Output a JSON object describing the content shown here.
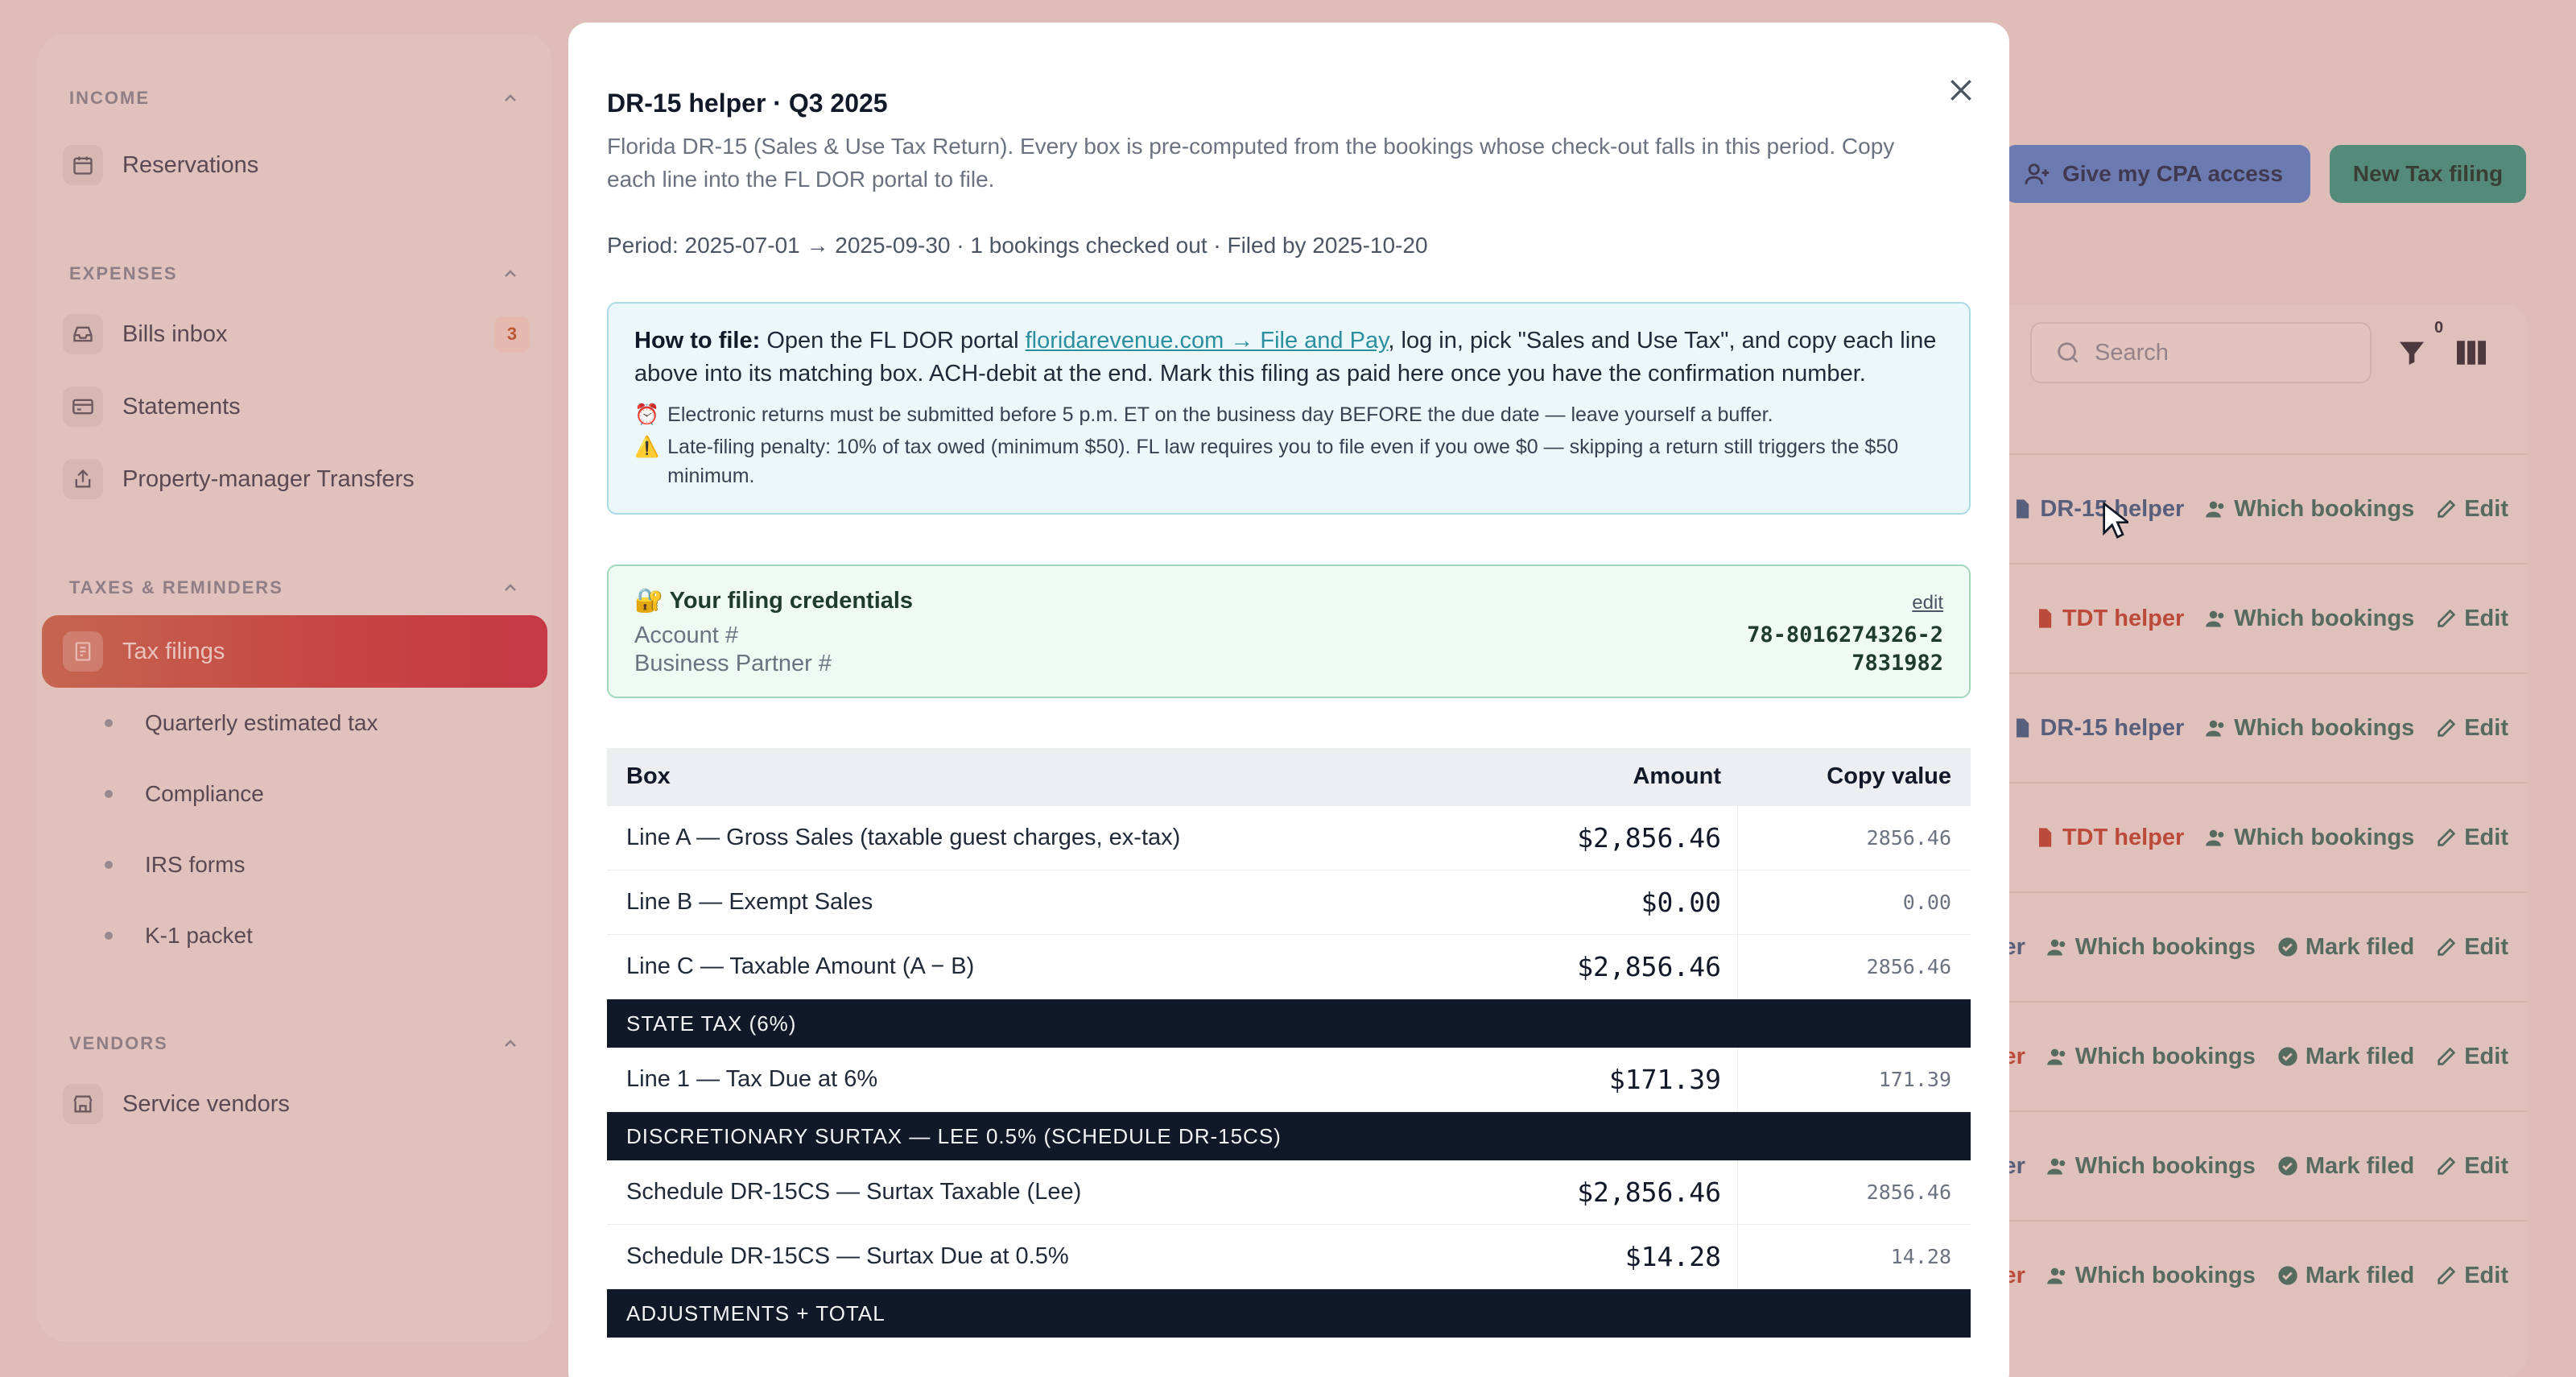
{
  "sidebar": {
    "income": {
      "title": "INCOME",
      "items": [
        {
          "label": "Reservations"
        }
      ]
    },
    "expenses": {
      "title": "EXPENSES",
      "items": [
        {
          "label": "Bills inbox",
          "badge": "3"
        },
        {
          "label": "Statements"
        },
        {
          "label": "Property-manager Transfers"
        }
      ]
    },
    "taxes": {
      "title": "TAXES & REMINDERS",
      "active": "Tax filings",
      "subitems": [
        "Quarterly estimated tax",
        "Compliance",
        "IRS forms",
        "K-1 packet"
      ]
    },
    "vendors": {
      "title": "VENDORS",
      "items": [
        {
          "label": "Service vendors"
        }
      ]
    }
  },
  "header": {
    "cpa_button": "Give my CPA access",
    "new_button": "New Tax filing"
  },
  "list": {
    "search_placeholder": "Search",
    "filter_count": "0",
    "rows": [
      {
        "a1": "DR-15 helper",
        "a2": "Which bookings",
        "a3": "Edit"
      },
      {
        "a1": "TDT helper",
        "a2": "Which bookings",
        "a3": "Edit"
      },
      {
        "a1": "DR-15 helper",
        "a2": "Which bookings",
        "a3": "Edit"
      },
      {
        "a1": "TDT helper",
        "a2": "Which bookings",
        "a3": "Edit"
      },
      {
        "a1": "er",
        "a2": "Which bookings",
        "a3": "Mark filed",
        "a4": "Edit"
      },
      {
        "a1": "er",
        "a2": "Which bookings",
        "a3": "Mark filed",
        "a4": "Edit"
      },
      {
        "a1": "er",
        "a2": "Which bookings",
        "a3": "Mark filed",
        "a4": "Edit"
      },
      {
        "a1": "er",
        "a2": "Which bookings",
        "a3": "Mark filed",
        "a4": "Edit"
      }
    ]
  },
  "modal": {
    "title": "DR-15 helper · Q3 2025",
    "description": "Florida DR-15 (Sales & Use Tax Return). Every box is pre-computed from the bookings whose check-out falls in this period. Copy each line into the FL DOR portal to file.",
    "period": "Period: 2025-07-01 → 2025-09-30 · 1 bookings checked out · Filed by 2025-10-20",
    "howto": {
      "label": "How to file:",
      "text_before": " Open the FL DOR portal ",
      "link": "floridarevenue.com → File and Pay",
      "text_after": ", log in, pick \"Sales and Use Tax\", and copy each line above into its matching box. ACH-debit at the end. Mark this filing as paid here once you have the confirmation number.",
      "note1_emoji": "⏰",
      "note1": "Electronic returns must be submitted before 5 p.m. ET on the business day BEFORE the due date — leave yourself a buffer.",
      "note2_emoji": "⚠️",
      "note2": "Late-filing penalty: 10% of tax owed (minimum $50). FL law requires you to file even if you owe $0 — skipping a return still triggers the $50 minimum."
    },
    "credentials": {
      "emoji": "🔐",
      "title": "Your filing credentials",
      "edit": "edit",
      "account_label": "Account #",
      "account_value": "78-8016274326-2",
      "bp_label": "Business Partner #",
      "bp_value": "7831982"
    },
    "table": {
      "headers": {
        "box": "Box",
        "amount": "Amount",
        "copy": "Copy value"
      },
      "rows1": [
        {
          "box": "Line A — Gross Sales (taxable guest charges, ex-tax)",
          "amount": "$2,856.46",
          "copy": "2856.46"
        },
        {
          "box": "Line B — Exempt Sales",
          "amount": "$0.00",
          "copy": "0.00"
        },
        {
          "box": "Line C — Taxable Amount (A − B)",
          "amount": "$2,856.46",
          "copy": "2856.46"
        }
      ],
      "band1": "STATE TAX (6%)",
      "rows2": [
        {
          "box": "Line 1 — Tax Due at 6%",
          "amount": "$171.39",
          "copy": "171.39"
        }
      ],
      "band2": "DISCRETIONARY SURTAX — LEE 0.5% (SCHEDULE DR-15CS)",
      "rows3": [
        {
          "box": "Schedule DR-15CS — Surtax Taxable (Lee)",
          "amount": "$2,856.46",
          "copy": "2856.46"
        },
        {
          "box": "Schedule DR-15CS — Surtax Due at 0.5%",
          "amount": "$14.28",
          "copy": "14.28"
        }
      ],
      "band3": "ADJUSTMENTS + TOTAL"
    }
  }
}
